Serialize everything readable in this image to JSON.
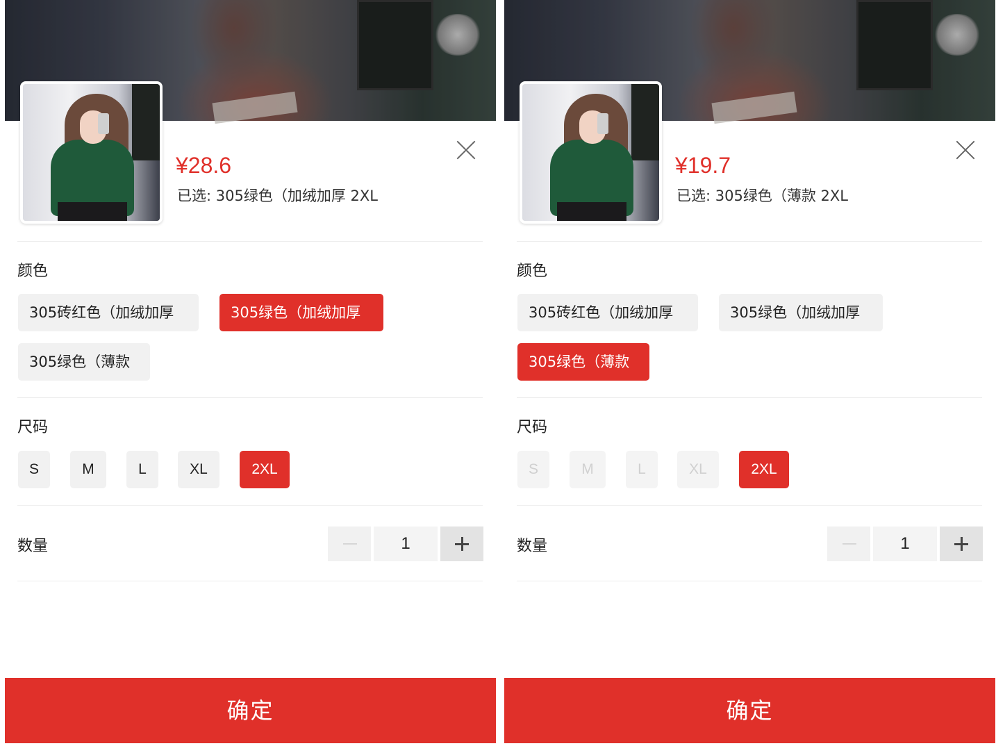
{
  "panels": [
    {
      "price": "¥28.6",
      "selected": "已选: 305绿色（加绒加厚 2XL",
      "color_title": "颜色",
      "colors": [
        {
          "label": "305砖红色（加绒加厚",
          "state": "normal"
        },
        {
          "label": "305绿色（加绒加厚",
          "state": "active"
        },
        {
          "label": "305绿色（薄款",
          "state": "normal"
        }
      ],
      "size_title": "尺码",
      "sizes": [
        {
          "label": "S",
          "state": "normal"
        },
        {
          "label": "M",
          "state": "normal"
        },
        {
          "label": "L",
          "state": "normal"
        },
        {
          "label": "XL",
          "state": "normal"
        },
        {
          "label": "2XL",
          "state": "active"
        }
      ],
      "qty_title": "数量",
      "qty_value": "1",
      "confirm_label": "确定"
    },
    {
      "price": "¥19.7",
      "selected": "已选: 305绿色（薄款 2XL",
      "color_title": "颜色",
      "colors": [
        {
          "label": "305砖红色（加绒加厚",
          "state": "normal"
        },
        {
          "label": "305绿色（加绒加厚",
          "state": "normal"
        },
        {
          "label": "305绿色（薄款",
          "state": "active"
        }
      ],
      "size_title": "尺码",
      "sizes": [
        {
          "label": "S",
          "state": "disabled"
        },
        {
          "label": "M",
          "state": "disabled"
        },
        {
          "label": "L",
          "state": "disabled"
        },
        {
          "label": "XL",
          "state": "disabled"
        },
        {
          "label": "2XL",
          "state": "active"
        }
      ],
      "qty_title": "数量",
      "qty_value": "1",
      "confirm_label": "确定"
    }
  ],
  "colors": {
    "accent": "#e0302a",
    "chip_bg": "#f1f1f1"
  }
}
